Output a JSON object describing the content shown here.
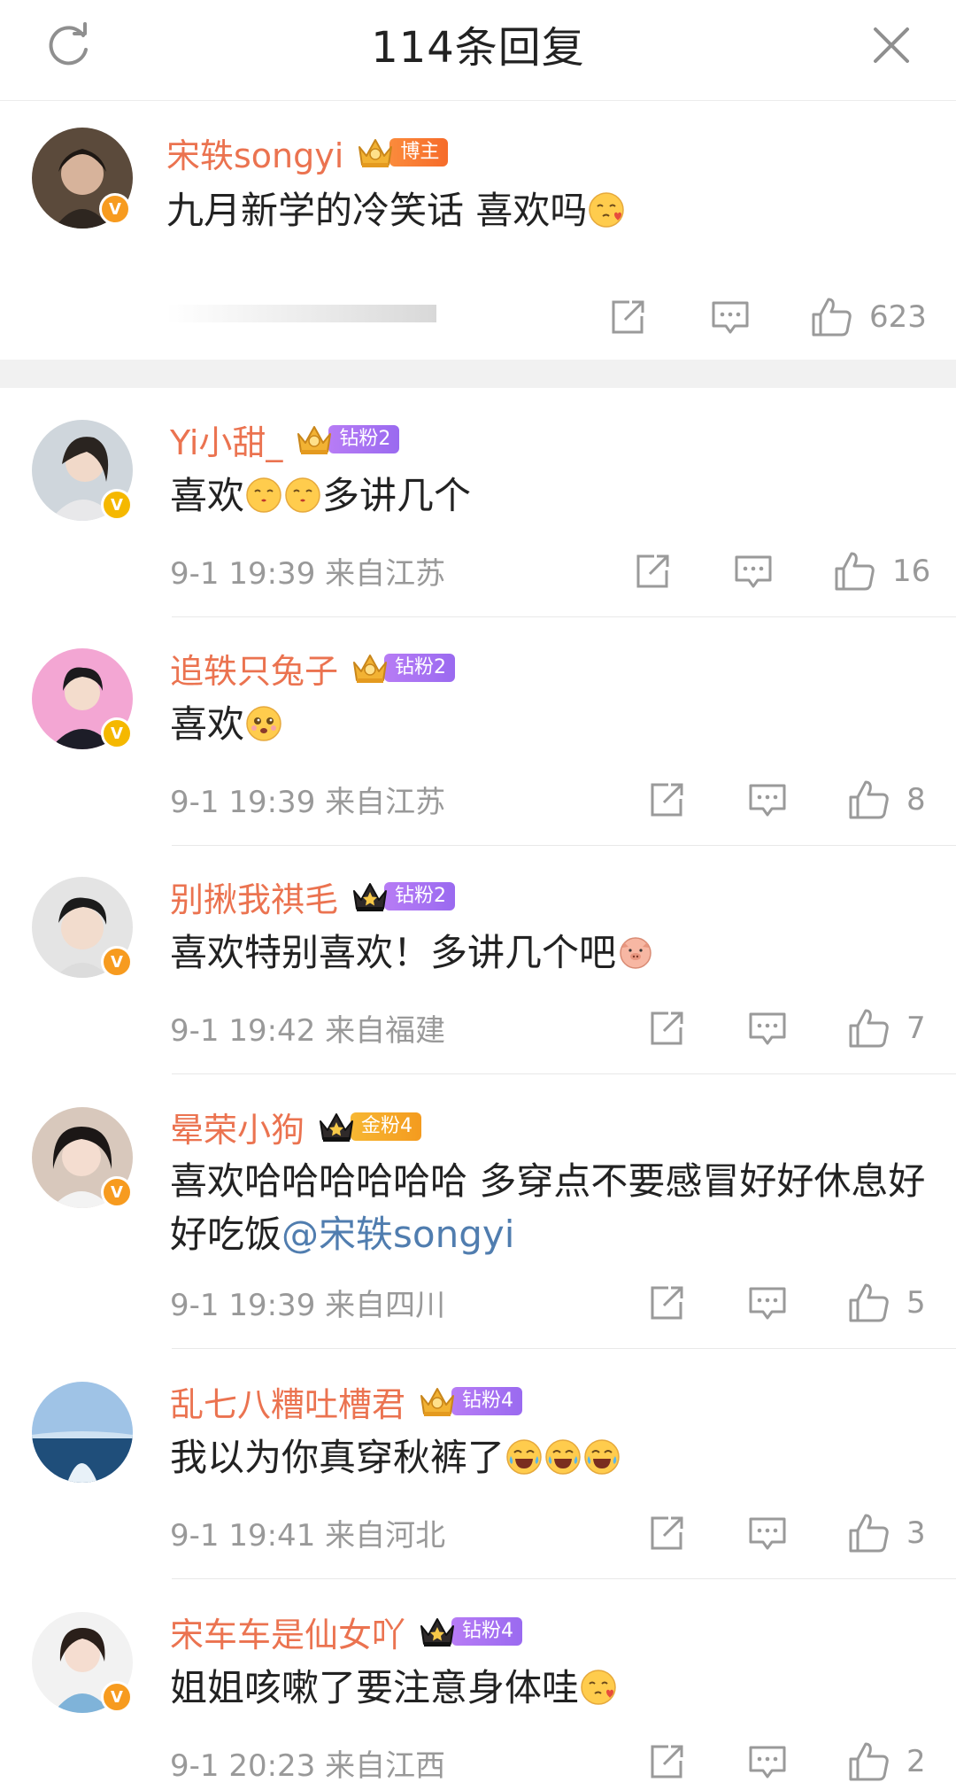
{
  "header": {
    "title": "114条回复"
  },
  "post": {
    "user": "宋轶songyi",
    "badge": "博主",
    "text": "九月新学的冷笑话 喜欢吗",
    "likes": "623"
  },
  "comments": [
    {
      "user": "Yi小甜_",
      "badge": "钻粉2",
      "text": "喜欢",
      "text_after": "多讲几个",
      "date": "9-1 19:39",
      "location": "来自江苏",
      "likes": "16"
    },
    {
      "user": "追轶只兔子",
      "badge": "钻粉2",
      "text": "喜欢",
      "date": "9-1 19:39",
      "location": "来自江苏",
      "likes": "8"
    },
    {
      "user": "别揪我祺毛",
      "badge": "钻粉2",
      "text": "喜欢特别喜欢！多讲几个吧",
      "date": "9-1 19:42",
      "location": "来自福建",
      "likes": "7"
    },
    {
      "user": "晕荣小狗",
      "badge": "金粉4",
      "text": "喜欢哈哈哈哈哈哈 多穿点不要感冒好好休息好好吃饭",
      "mention": "@宋轶songyi",
      "date": "9-1 19:39",
      "location": "来自四川",
      "likes": "5"
    },
    {
      "user": "乱七八糟吐槽君",
      "badge": "钻粉4",
      "text": "我以为你真穿秋裤了",
      "date": "9-1 19:41",
      "location": "来自河北",
      "likes": "3"
    },
    {
      "user": "宋车车是仙女吖",
      "badge": "钻粉4",
      "text": "姐姐咳嗽了要注意身体哇",
      "date": "9-1 20:23",
      "location": "来自江西",
      "likes": "2"
    }
  ],
  "icons": {
    "refresh": "refresh-icon",
    "close": "close-icon",
    "share": "share-icon",
    "comment": "comment-icon",
    "like": "thumbs-up-icon"
  },
  "colors": {
    "username": "#eb7350",
    "mention": "#507daf",
    "meta": "#999999",
    "verified": "#f79b1f"
  }
}
